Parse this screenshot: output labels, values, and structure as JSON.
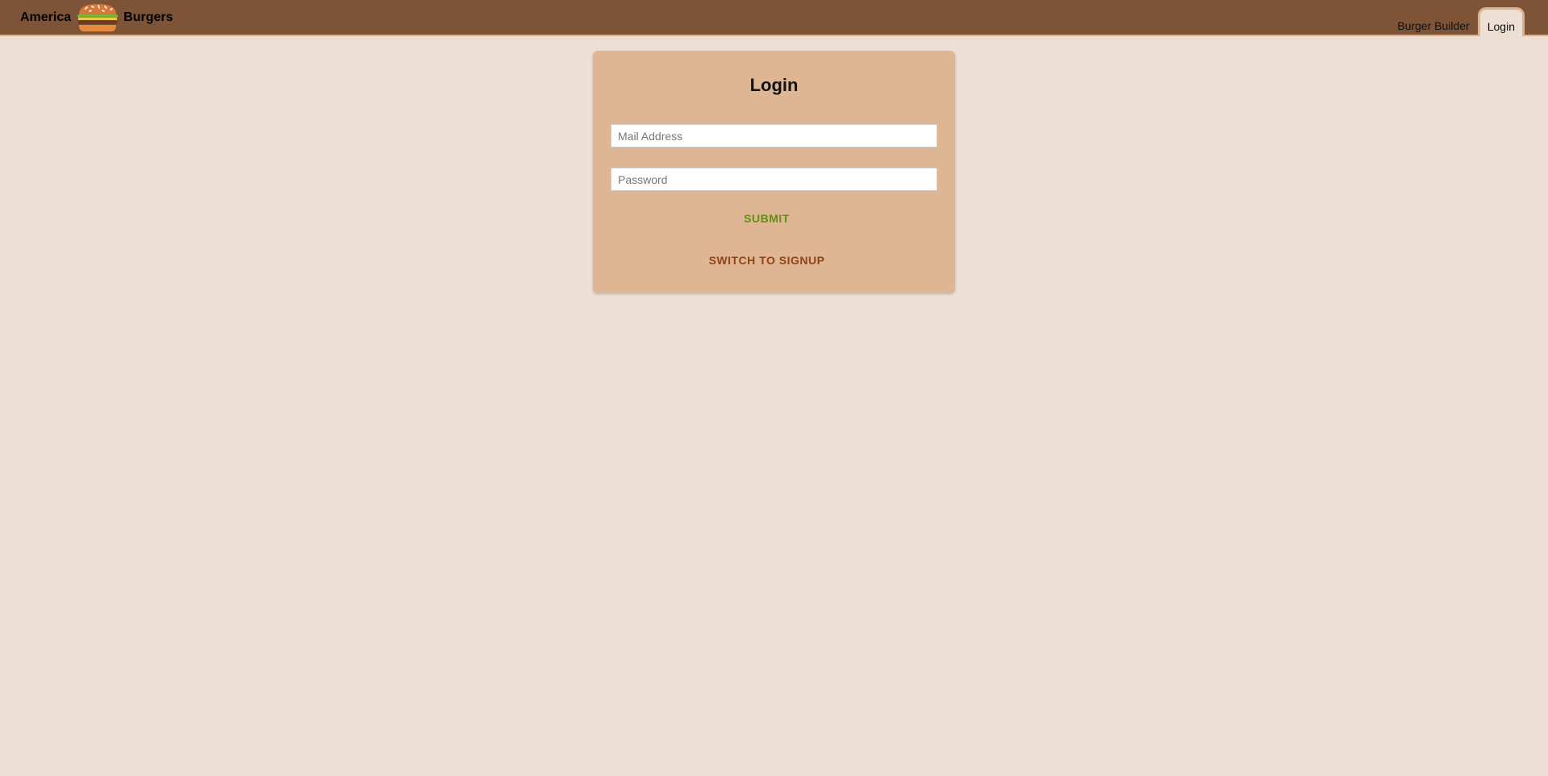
{
  "header": {
    "brand_left": "America",
    "brand_right": "Burgers",
    "logo_icon": "burger-logo-icon",
    "nav": [
      {
        "label": "Burger Builder",
        "active": false
      },
      {
        "label": "Login",
        "active": true
      }
    ]
  },
  "auth_card": {
    "title": "Login",
    "email_placeholder": "Mail Address",
    "password_placeholder": "Password",
    "submit_label": "SUBMIT",
    "switch_label": "SWITCH TO SIGNUP"
  },
  "colors": {
    "toolbar": "#7d5438",
    "background": "#ece0d4",
    "card": "#dfb693",
    "submit": "#5c9210",
    "switch": "#944317"
  }
}
